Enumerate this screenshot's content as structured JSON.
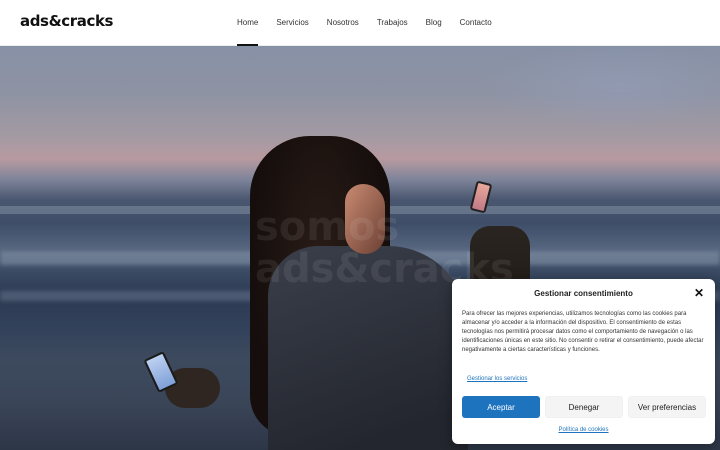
{
  "site": {
    "logo": "ads&cracks"
  },
  "nav": {
    "items": [
      {
        "label": "Home",
        "active": true
      },
      {
        "label": "Servicios",
        "active": false
      },
      {
        "label": "Nosotros",
        "active": false
      },
      {
        "label": "Trabajos",
        "active": false
      },
      {
        "label": "Blog",
        "active": false
      },
      {
        "label": "Contacto",
        "active": false
      }
    ]
  },
  "hero": {
    "watermark_line1": "somos",
    "watermark_line2": "ads&cracks"
  },
  "consent": {
    "title": "Gestionar consentimiento",
    "body": "Para ofrecer las mejores experiencias, utilizamos tecnologías como las cookies para almacenar y/o acceder a la información del dispositivo. El consentimiento de estas tecnologías nos permitirá procesar datos como el comportamiento de navegación o las identificaciones únicas en este sitio. No consentir o retirar el consentimiento, puede afectar negativamente a ciertas características y funciones.",
    "manage_link": "Gestionar los servicios",
    "accept_label": "Aceptar",
    "deny_label": "Denegar",
    "prefs_label": "Ver preferencias",
    "policy_link": "Política de cookies",
    "close_icon": "close-icon"
  },
  "colors": {
    "accent": "#1e73be",
    "nav_text": "#333333"
  }
}
